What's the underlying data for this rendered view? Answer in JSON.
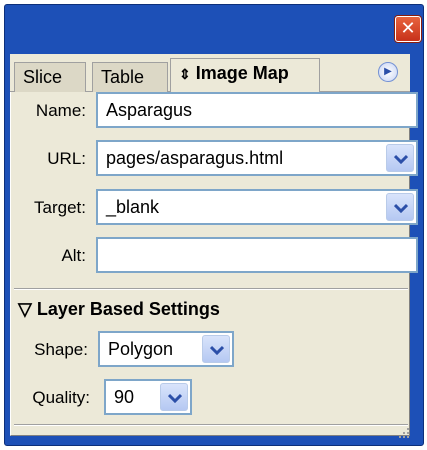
{
  "window": {
    "close_icon": "close-icon",
    "panel_color": "#1d50b7"
  },
  "tabs": [
    {
      "label": "Slice",
      "active": false
    },
    {
      "label": "Table",
      "active": false
    },
    {
      "label": "Image Map",
      "active": true,
      "icon": "up-down-arrows-icon"
    }
  ],
  "panel_menu_icon": "panel-menu-icon",
  "form": {
    "name": {
      "label": "Name:",
      "value": "Asparagus"
    },
    "url": {
      "label": "URL:",
      "value": "pages/asparagus.html"
    },
    "target": {
      "label": "Target:",
      "value": "_blank"
    },
    "alt": {
      "label": "Alt:",
      "value": ""
    }
  },
  "layer_settings": {
    "title": "Layer Based Settings",
    "shape": {
      "label": "Shape:",
      "value": "Polygon"
    },
    "quality": {
      "label": "Quality:",
      "value": "90"
    }
  }
}
